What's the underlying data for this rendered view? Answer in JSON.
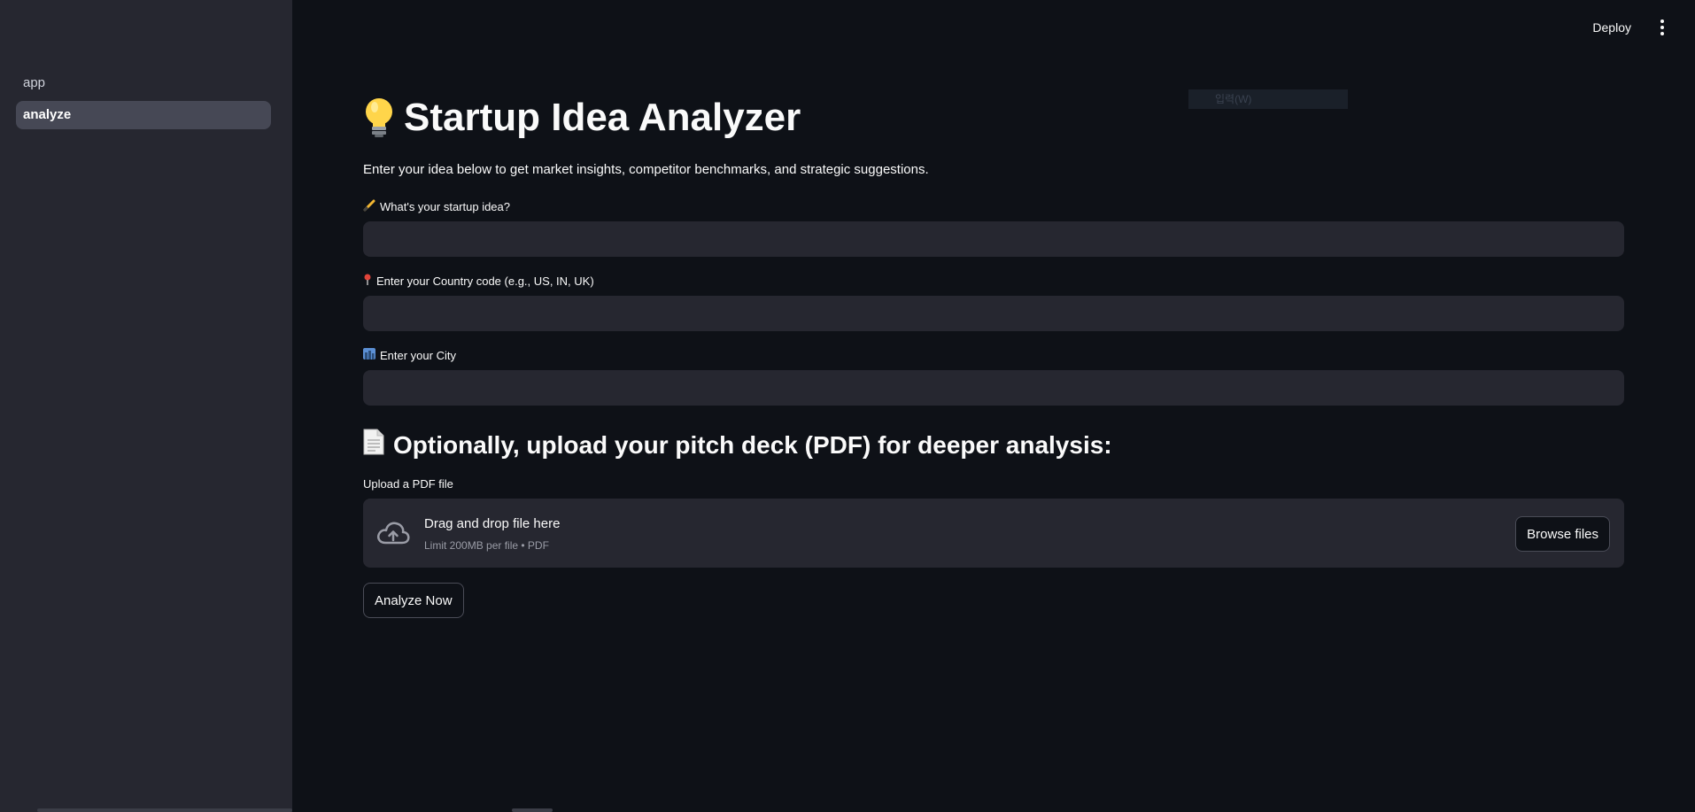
{
  "sidebar": {
    "items": [
      {
        "label": "app",
        "active": false
      },
      {
        "label": "analyze",
        "active": true
      }
    ]
  },
  "header": {
    "deploy_label": "Deploy",
    "menu_icon": "more-vertical-icon"
  },
  "overlay": {
    "text": "입력(W)"
  },
  "main": {
    "title": "Startup Idea Analyzer",
    "title_icon": "lightbulb-icon",
    "intro": "Enter your idea below to get market insights, competitor benchmarks, and strategic suggestions.",
    "fields": [
      {
        "icon": "pencil-icon",
        "label": "What's your startup idea?",
        "value": "",
        "placeholder": ""
      },
      {
        "icon": "pin-icon",
        "label": "Enter your Country code (e.g., US, IN, UK)",
        "value": "",
        "placeholder": ""
      },
      {
        "icon": "city-icon",
        "label": "Enter your City",
        "value": "",
        "placeholder": ""
      }
    ],
    "upload_section": {
      "heading": "Optionally, upload your pitch deck (PDF) for deeper analysis:",
      "heading_icon": "page-icon",
      "label": "Upload a PDF file",
      "drop_title": "Drag and drop file here",
      "drop_limit": "Limit 200MB per file • PDF",
      "browse_label": "Browse files"
    },
    "analyze_label": "Analyze Now"
  },
  "colors": {
    "background": "#0e1117",
    "sidebar": "#262730",
    "input": "#262730",
    "text": "#fafafa"
  }
}
